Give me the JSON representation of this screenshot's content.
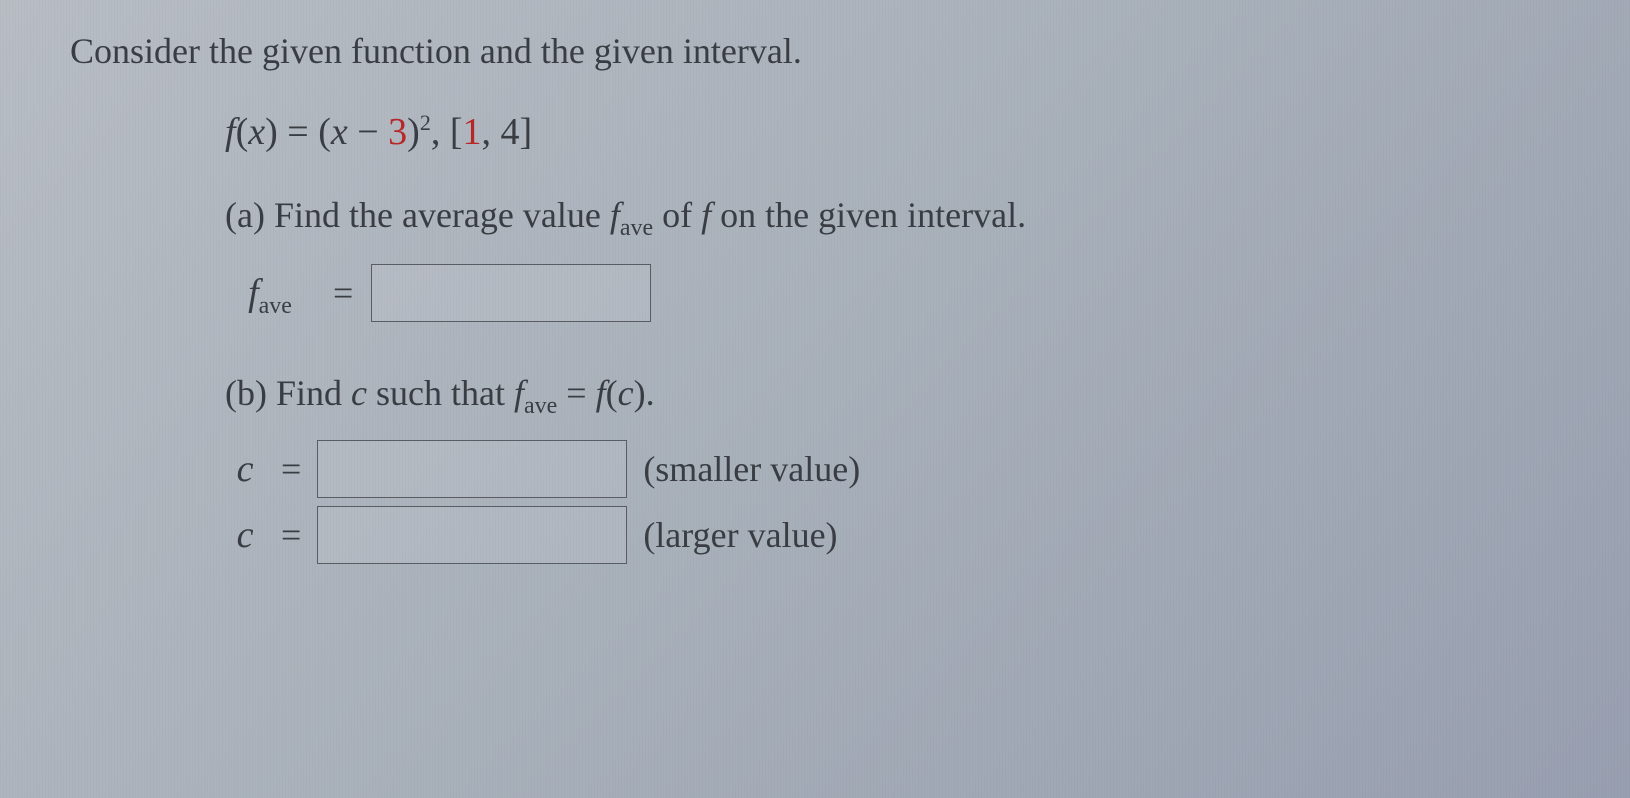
{
  "intro": "Consider the given function and the given interval.",
  "func": {
    "lhs_f": "f",
    "lhs_open": "(",
    "lhs_x": "x",
    "lhs_close": ")",
    "eq": " = ",
    "open": "(",
    "x": "x",
    "minus": " − ",
    "three": "3",
    "close": ")",
    "exp": "2",
    "comma": ",",
    "gap": "    ",
    "bracket_open": "[",
    "one": "1",
    "sep": ", ",
    "four": "4",
    "bracket_close": "]"
  },
  "part_a": {
    "prefix": "(a) Find the average value ",
    "f": "f",
    "sub": "ave",
    "middle": " of ",
    "f2": "f",
    "suffix": " on the given interval."
  },
  "fave": {
    "f": "f",
    "sub": "ave",
    "eq": "="
  },
  "part_b": {
    "prefix": "(b) Find ",
    "c": "c",
    "mid": " such that ",
    "f": "f",
    "sub": "ave",
    "eq": " = ",
    "f2": "f",
    "open": "(",
    "c2": "c",
    "close": ")",
    "dot": "."
  },
  "c_rows": {
    "c": "c",
    "eq": "=",
    "smaller": "(smaller value)",
    "larger": "(larger value)"
  }
}
